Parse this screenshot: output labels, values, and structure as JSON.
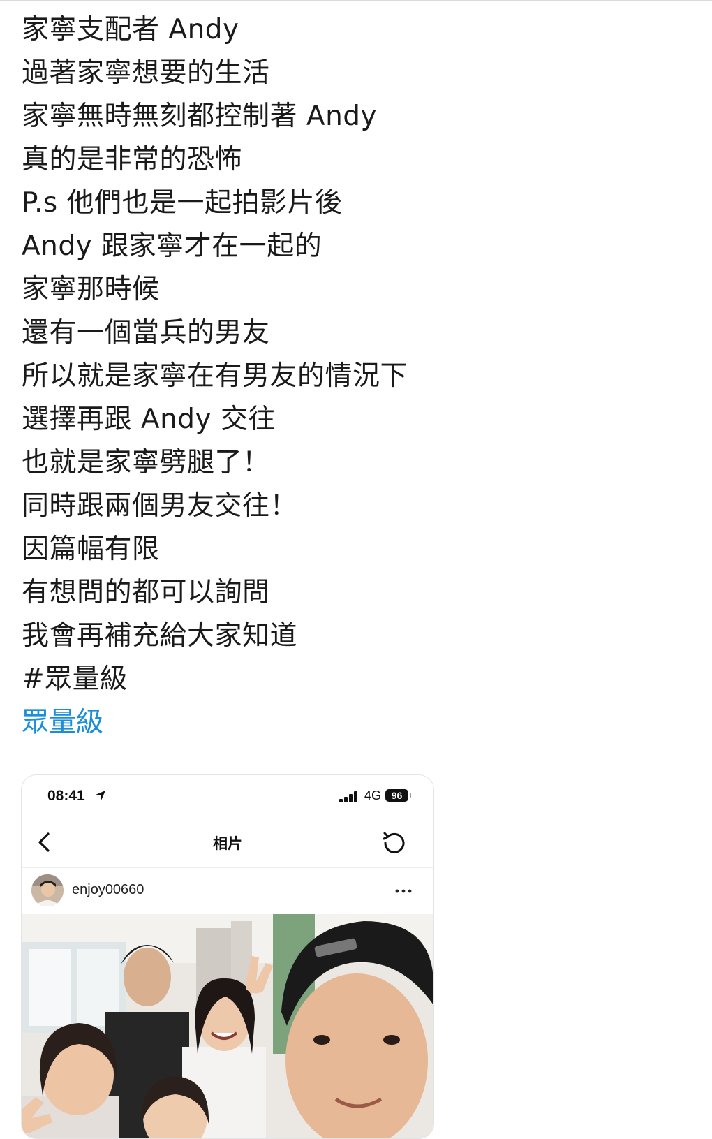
{
  "post": {
    "lines": [
      "家寧支配者 Andy",
      "過著家寧想要的生活",
      "家寧無時無刻都控制著 Andy",
      "真的是非常的恐怖",
      "P.s 他們也是一起拍影片後",
      "Andy 跟家寧才在一起的",
      "家寧那時候",
      "還有一個當兵的男友",
      "所以就是家寧在有男友的情況下",
      "選擇再跟 Andy 交往",
      "也就是家寧劈腿了！",
      "同時跟兩個男友交往！",
      "因篇幅有限",
      "有想問的都可以詢問",
      "我會再補充給大家知道",
      "#眾量級"
    ],
    "hashtag_link": "眾量級",
    "link_color": "#1a8ed8"
  },
  "embedded_screenshot": {
    "status": {
      "time": "08:41",
      "network": "4G",
      "battery": "96"
    },
    "nav": {
      "title": "相片",
      "back_icon": "chevron-left-icon",
      "refresh_icon": "refresh-icon"
    },
    "post_header": {
      "username": "enjoy00660",
      "more_icon": "more-horizontal-icon"
    }
  }
}
